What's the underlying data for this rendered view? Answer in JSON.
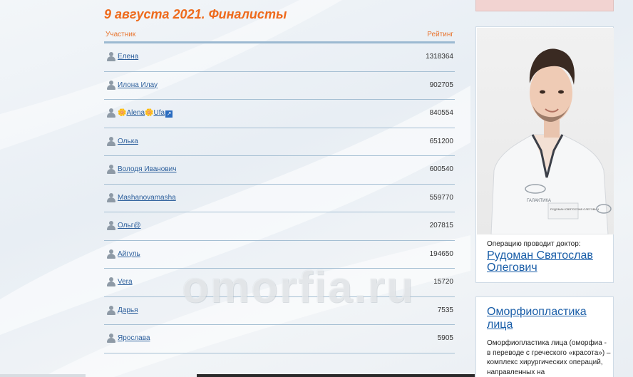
{
  "main": {
    "title": "9 августа 2021. Финалисты",
    "col_participant": "Участник",
    "col_rating": "Рейтинг",
    "rows": [
      {
        "name": "Елена",
        "rating": "1318364"
      },
      {
        "name": "Илона Илау",
        "rating": "902705"
      },
      {
        "name_prefix": "🌼",
        "name_a": "Alena",
        "name_mid": "🌼",
        "name_b": "Ufa",
        "name_suffix": "↗",
        "rating": "840554"
      },
      {
        "name": "Олька",
        "rating": "651200"
      },
      {
        "name": "Володя Иванович",
        "rating": "600540"
      },
      {
        "name": "Mashanovamasha",
        "rating": "559770"
      },
      {
        "name": "Ольг@",
        "rating": "207815"
      },
      {
        "name": "Айгуль",
        "rating": "194650"
      },
      {
        "name": "Vera",
        "rating": "15720"
      },
      {
        "name": "Дарья",
        "rating": "7535"
      },
      {
        "name": "Ярослава",
        "rating": "5905"
      }
    ],
    "watermark": "omorfia.ru"
  },
  "sidebar": {
    "doctor_label": "Операцию проводит доктор:",
    "doctor_name": "Рудоман Святослав Олегович",
    "coat_logo": "ГАЛАКТИКА",
    "coat_badge": "РУДОМАН СВЯТОСЛАВ ОЛЕГОВИЧ",
    "procedure_title": "Оморфиопластика лица",
    "procedure_text": "Оморфиопластика лица (оморфиа - в переводе с греческого «красота») – комплекс хирургических операций, направленных на"
  },
  "colors": {
    "title": "#ee6a1c",
    "link": "#2b5e9b",
    "divider": "#a5bfd3"
  }
}
